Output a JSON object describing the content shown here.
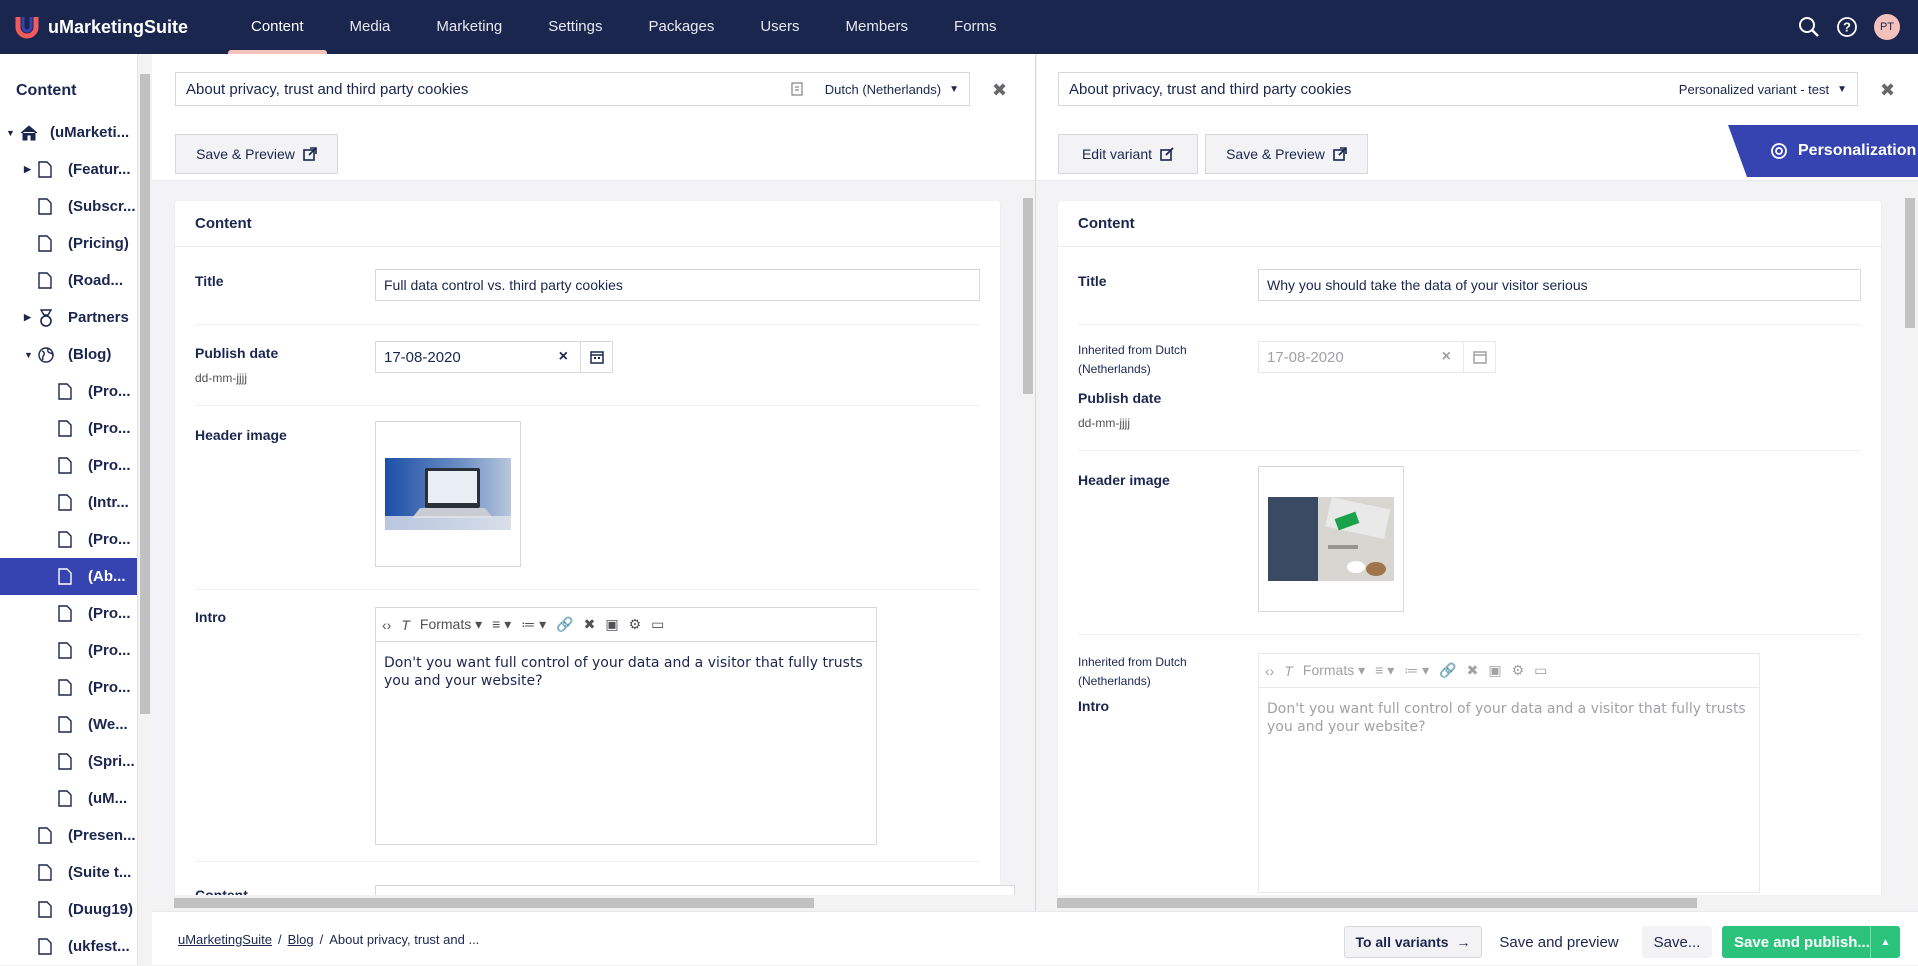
{
  "app": {
    "name": "uMarketingSuite"
  },
  "nav": {
    "items": [
      "Content",
      "Media",
      "Marketing",
      "Settings",
      "Packages",
      "Users",
      "Members",
      "Forms"
    ],
    "active": "Content"
  },
  "user": {
    "initials": "PT"
  },
  "tree": {
    "heading": "Content",
    "items": [
      "(uMarketi...",
      "(Featur...",
      "(Subscr...",
      "(Pricing)",
      "(Road...",
      "Partners",
      "(Blog)",
      "(Pro...",
      "(Pro...",
      "(Pro...",
      "(Intr...",
      "(Pro...",
      "(Ab...",
      "(Pro...",
      "(Pro...",
      "(Pro...",
      "(We...",
      "(Spri...",
      "(uM...",
      "(Presen...",
      "(Suite t...",
      "(Duug19)",
      "(ukfest..."
    ]
  },
  "left": {
    "name": "About privacy, trust and third party cookies",
    "language": "Dutch (Netherlands)",
    "save_preview": "Save & Preview",
    "group": "Content",
    "title_label": "Title",
    "title_value": "Full data control vs. third party cookies",
    "publish_label": "Publish date",
    "publish_desc": "dd-mm-jjjj",
    "publish_value": "17-08-2020",
    "header_label": "Header image",
    "intro_label": "Intro",
    "formats": "Formats",
    "intro_text": "Don't you want full control of your data and a visitor that fully trusts you and your website?",
    "content_label": "Content"
  },
  "right": {
    "name": "About privacy, trust and third party cookies",
    "variant": "Personalized variant - test",
    "edit_variant": "Edit variant",
    "save_preview": "Save & Preview",
    "personalization": "Personalization",
    "group": "Content",
    "title_label": "Title",
    "title_value": "Why you should take the data of your visitor serious",
    "inherited": "Inherited from Dutch (Netherlands)",
    "publish_label": "Publish date",
    "publish_desc": "dd-mm-jjjj",
    "publish_value": "17-08-2020",
    "header_label": "Header image",
    "intro_label": "Intro",
    "formats": "Formats",
    "intro_text": "Don't you want full control of your data and a visitor that fully trusts you and your website?"
  },
  "footer": {
    "crumbs": [
      "uMarketingSuite",
      "Blog",
      "About privacy, trust and ..."
    ],
    "to_all_variants": "To all variants",
    "save_and_preview": "Save and preview",
    "save": "Save...",
    "save_and_publish": "Save and publish..."
  },
  "colors": {
    "topbar": "#1b264f",
    "accent": "#3544b1",
    "publish": "#2bc37c",
    "active_underline": "#f5c1bc"
  }
}
